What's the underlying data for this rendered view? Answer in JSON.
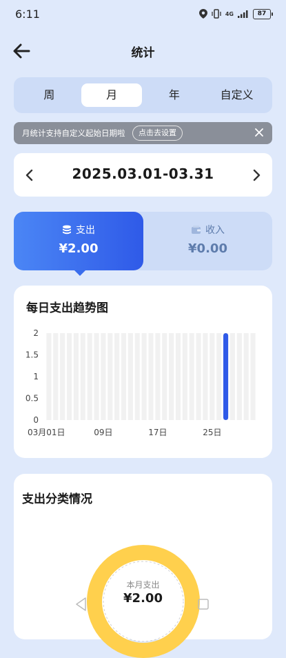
{
  "status_bar": {
    "time": "6:11",
    "battery": "87",
    "network": "4G"
  },
  "header": {
    "title": "统计"
  },
  "period_tabs": [
    {
      "label": "周"
    },
    {
      "label": "月"
    },
    {
      "label": "年"
    },
    {
      "label": "自定义"
    }
  ],
  "selected_period": "月",
  "notice": {
    "text": "月统计支持自定义起始日期啦",
    "button": "点击去设置"
  },
  "date_range": "2025.03.01-03.31",
  "summary": {
    "expense": {
      "label": "支出",
      "amount": "¥2.00"
    },
    "income": {
      "label": "收入",
      "amount": "¥0.00"
    }
  },
  "trend": {
    "title": "每日支出趋势图"
  },
  "chart_data": {
    "type": "bar",
    "title": "每日支出趋势图",
    "x_tick_labels": [
      "03月01日",
      "09日",
      "17日",
      "25日"
    ],
    "x_tick_days": [
      1,
      9,
      17,
      25
    ],
    "y_ticks": [
      "2",
      "1.5",
      "1",
      "0.5",
      "0"
    ],
    "ylim": [
      0,
      2
    ],
    "days": [
      1,
      2,
      3,
      4,
      5,
      6,
      7,
      8,
      9,
      10,
      11,
      12,
      13,
      14,
      15,
      16,
      17,
      18,
      19,
      20,
      21,
      22,
      23,
      24,
      25,
      26,
      27,
      28,
      29,
      30,
      31
    ],
    "values": [
      0,
      0,
      0,
      0,
      0,
      0,
      0,
      0,
      0,
      0,
      0,
      0,
      0,
      0,
      0,
      0,
      0,
      0,
      0,
      0,
      0,
      0,
      0,
      0,
      0,
      0,
      2,
      0,
      0,
      0,
      0
    ],
    "grid": false,
    "colors": {
      "bar": "#2f5ae8",
      "background_column": "#f1f1f1"
    }
  },
  "category": {
    "title": "支出分类情况",
    "donut_label": "本月支出",
    "donut_amount": "¥2.00",
    "donut_color": "#ffd04d"
  }
}
